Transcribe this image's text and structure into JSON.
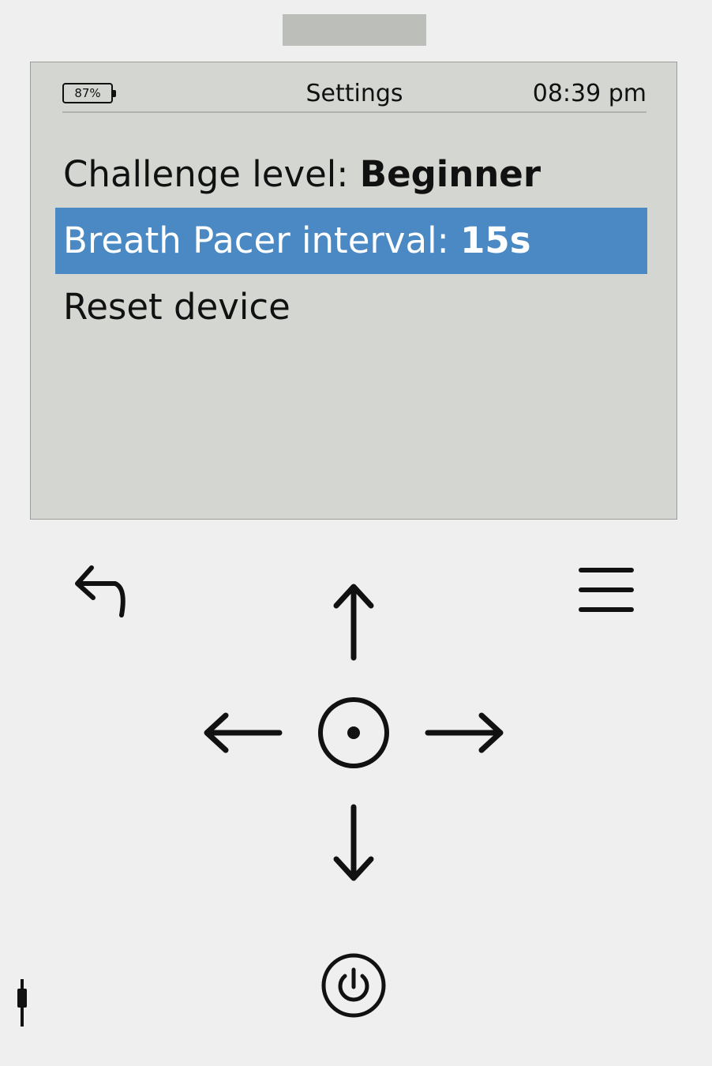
{
  "status": {
    "battery": "87%",
    "title": "Settings",
    "time": "08:39 pm"
  },
  "menu": {
    "items": [
      {
        "label": "Challenge level: ",
        "value": "Beginner",
        "selected": false
      },
      {
        "label": "Breath Pacer interval: ",
        "value": "15s",
        "selected": true
      },
      {
        "label": "Reset device",
        "value": "",
        "selected": false
      }
    ]
  },
  "icons": {
    "back": "undo-arrow-icon",
    "menu": "hamburger-menu-icon",
    "up": "arrow-up-icon",
    "down": "arrow-down-icon",
    "left": "arrow-left-icon",
    "right": "arrow-right-icon",
    "select": "select-circle-icon",
    "power": "power-icon",
    "jack": "audio-jack-icon"
  },
  "colors": {
    "screen_background": "#d4d7d1",
    "selection": "#4a89c4",
    "device_body": "#efefef"
  }
}
